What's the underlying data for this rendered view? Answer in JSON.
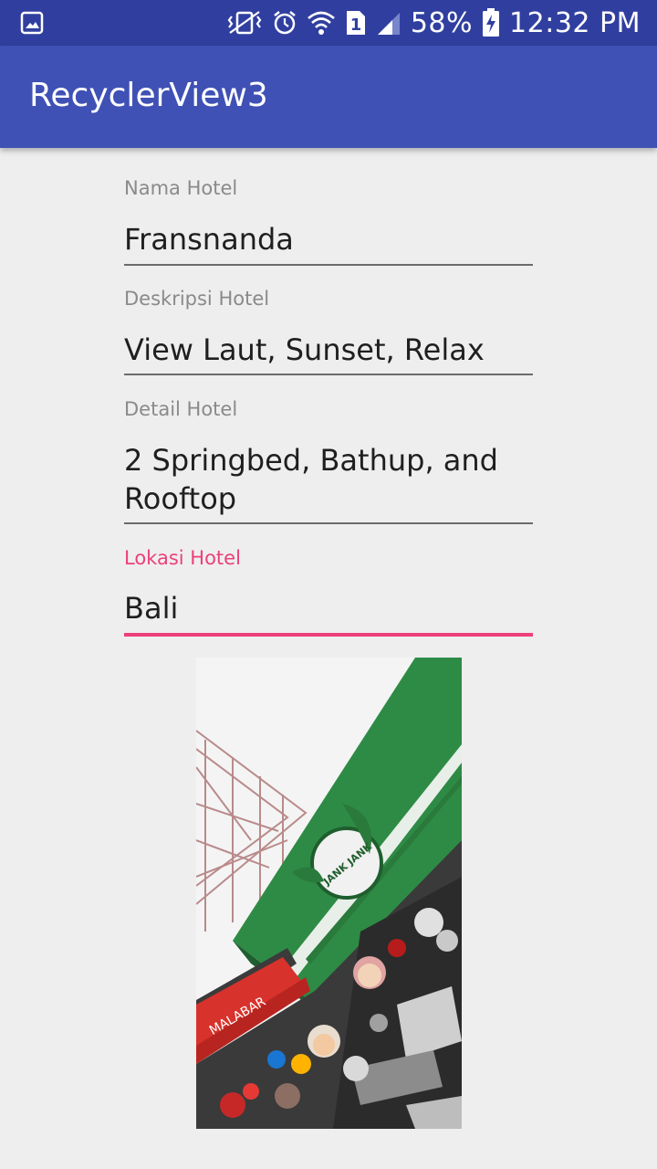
{
  "status_bar": {
    "battery": "58%",
    "time": "12:32 PM",
    "sim_slot": "1",
    "icons": [
      "gallery-icon",
      "vibrate-icon",
      "alarm-icon",
      "wifi-icon",
      "sim-icon",
      "signal-icon",
      "battery-charging-icon"
    ]
  },
  "app_bar": {
    "title": "RecyclerView3"
  },
  "form": {
    "nama": {
      "label": "Nama Hotel",
      "value": "Fransnanda"
    },
    "deskripsi": {
      "label": "Deskripsi Hotel",
      "value": "View Laut, Sunset, Relax"
    },
    "detail": {
      "label": "Detail Hotel",
      "value": "2 Springbed, Bathup, and Rooftop"
    },
    "lokasi": {
      "label": "Lokasi Hotel",
      "value": "Bali"
    }
  },
  "photo": {
    "sign_text": "JANK JANK",
    "banner_text": "MALABAR"
  },
  "colors": {
    "status_bar": "#303f9f",
    "app_bar": "#3f51b5",
    "accent": "#ec407a",
    "background": "#eeeeee"
  }
}
